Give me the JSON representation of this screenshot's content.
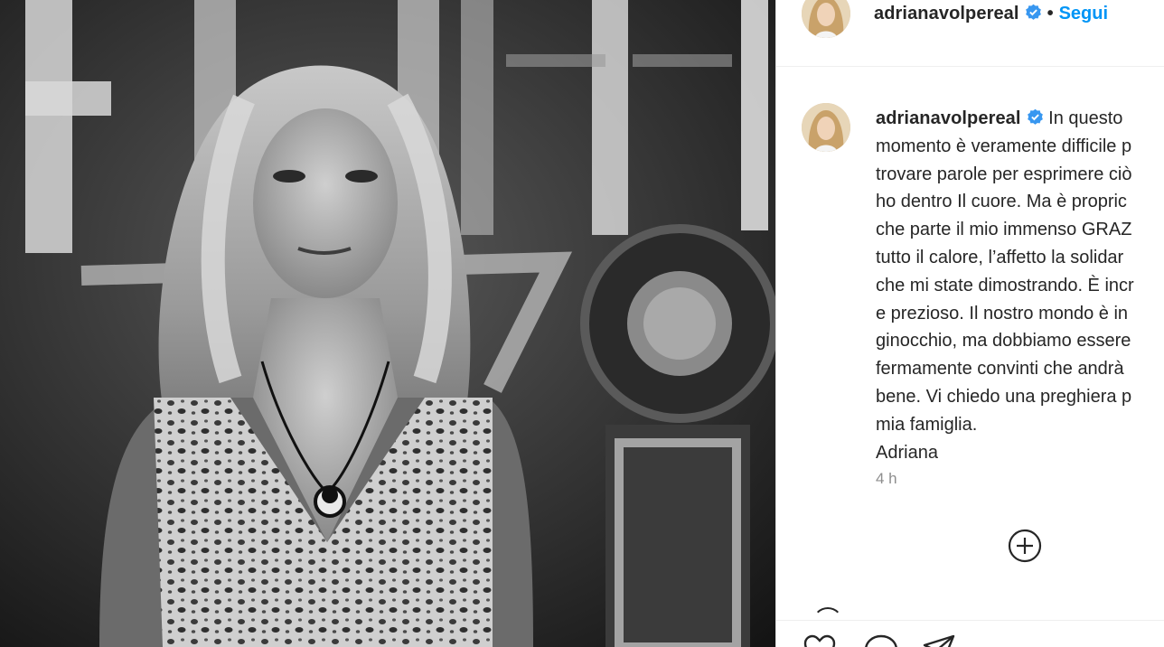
{
  "post": {
    "image_alt": "Black and white photo of a woman with wavy blonde hair wearing a sequined animal-print dress and a pendant necklace, standing on a TV studio stage"
  },
  "header": {
    "username": "adrianavolpereal",
    "separator": "•",
    "follow_label": "Segui"
  },
  "caption": {
    "username": "adrianavolpereal",
    "text": "In questo\nmomento è veramente difficile p\ntrovare parole per esprimere ciò\nho dentro Il cuore. Ma è propric\nche parte il mio immenso GRAZ\ntutto il calore, l’affetto la solidar\nche mi state dimostrando. È incr\ne prezioso. Il nostro mondo è in\nginocchio, ma dobbiamo essere\nfermamente convinti che andrà\nbene. Vi chiedo una preghiera p\nmia famiglia.\nAdriana",
    "timestamp": "4 h"
  },
  "icons": {
    "verified": "verified-badge-icon",
    "load_more": "plus-circle-icon",
    "like": "heart-icon",
    "comment": "comment-icon",
    "share": "share-icon"
  },
  "colors": {
    "accent": "#0095f6",
    "text": "#262626",
    "muted": "#8e8e8e",
    "verified": "#3897f0"
  }
}
